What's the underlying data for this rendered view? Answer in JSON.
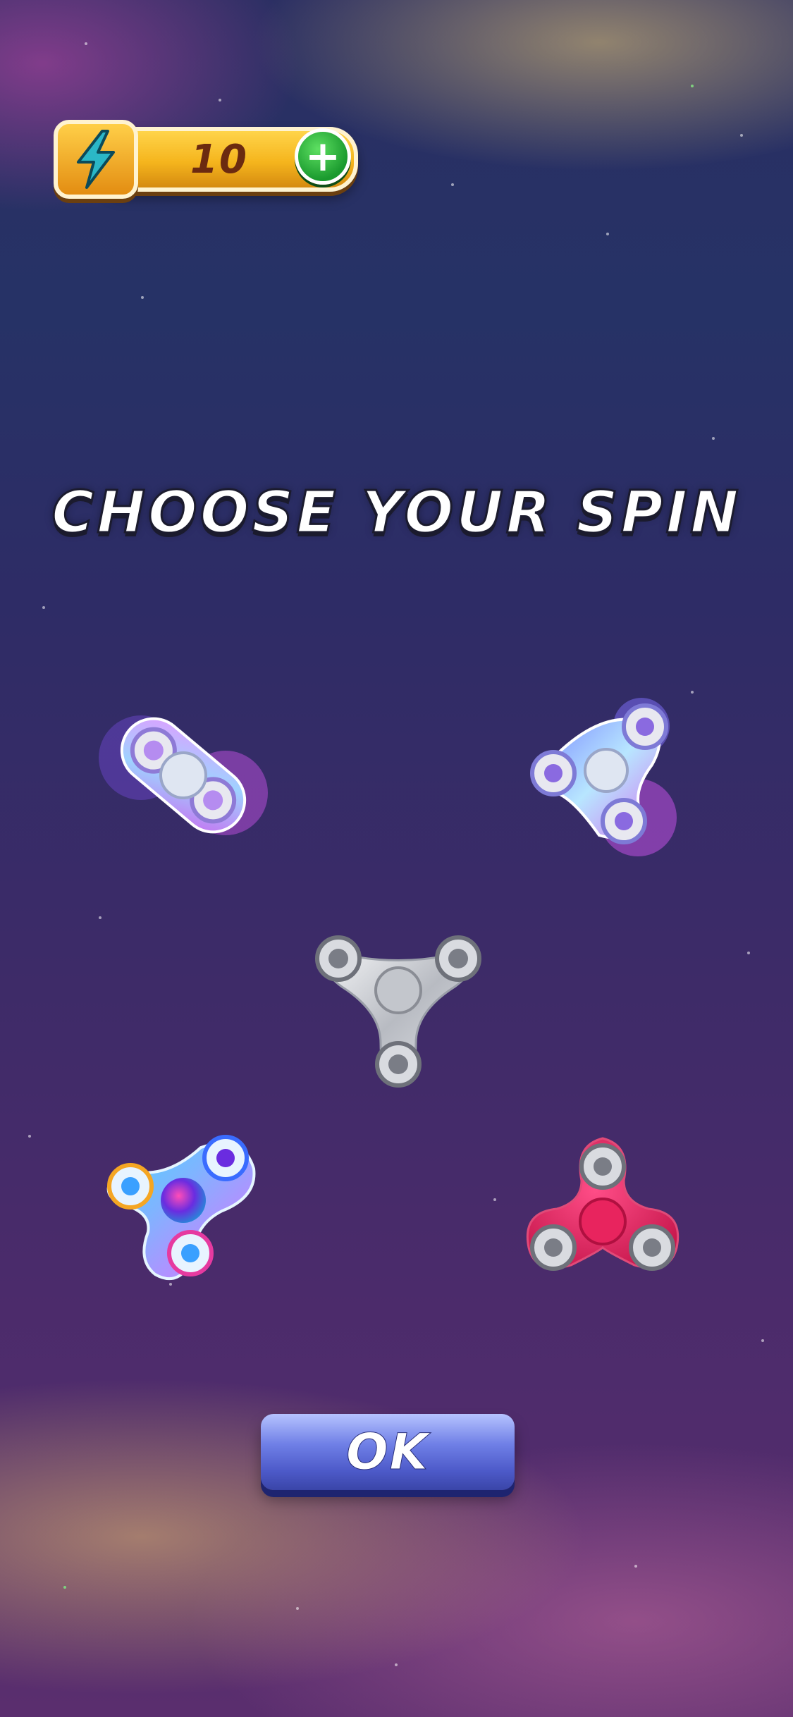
{
  "energy": {
    "value": "10",
    "icon": "lightning-bolt-icon",
    "add_icon": "plus-icon"
  },
  "title": "CHOOSE YOUR SPIN",
  "spinners": [
    {
      "name": "purple-blue-bar-spinner"
    },
    {
      "name": "purple-blue-tri-spinner"
    },
    {
      "name": "silver-tri-spinner"
    },
    {
      "name": "rainbow-tri-spinner"
    },
    {
      "name": "pink-tri-spinner"
    }
  ],
  "ok_button": {
    "label": "OK"
  },
  "colors": {
    "energy_bar": "#f5b51d",
    "plus_button": "#1a9a2e",
    "ok_button": "#4d5ac9",
    "pink_spinner": "#d8245a",
    "silver_spinner": "#c9cbd0"
  }
}
